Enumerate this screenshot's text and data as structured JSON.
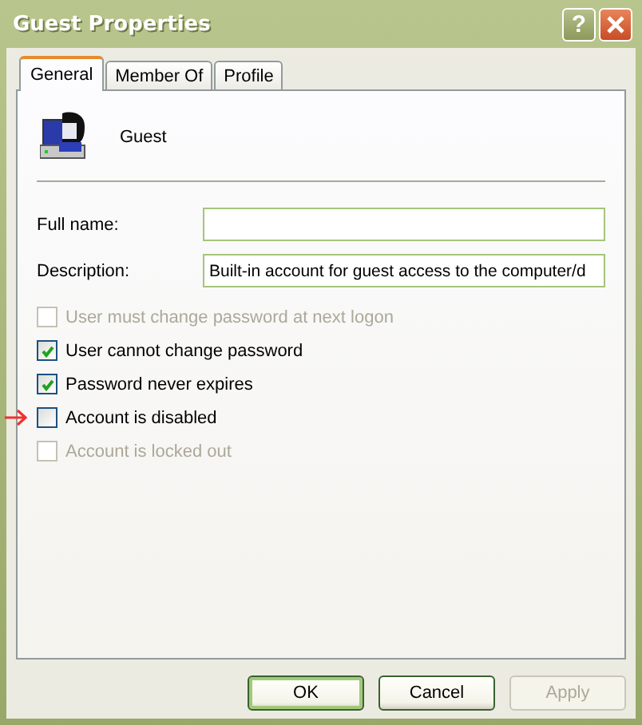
{
  "window": {
    "title": "Guest Properties",
    "help_button": "?"
  },
  "tabs": [
    {
      "label": "General",
      "selected": true
    },
    {
      "label": "Member Of",
      "selected": false
    },
    {
      "label": "Profile",
      "selected": false
    }
  ],
  "user": {
    "name": "Guest"
  },
  "fields": [
    {
      "label": "Full name:"
    },
    {
      "label": "Description:",
      "value": "Built-in account for guest access to the computer/d"
    }
  ],
  "options": [
    {
      "label": "User must change password at next logon",
      "checked": false,
      "disabled": true
    },
    {
      "label": "User cannot change password",
      "checked": true,
      "disabled": false
    },
    {
      "label": "Password never expires",
      "checked": true,
      "disabled": false
    },
    {
      "label": "Account is disabled",
      "checked": false,
      "disabled": false,
      "marked": true
    },
    {
      "label": "Account is locked out",
      "checked": false,
      "disabled": true
    }
  ],
  "buttons": [
    {
      "label": "OK",
      "default": true,
      "disabled": false
    },
    {
      "label": "Cancel",
      "default": false,
      "disabled": false
    },
    {
      "label": "Apply",
      "default": false,
      "disabled": true
    }
  ]
}
